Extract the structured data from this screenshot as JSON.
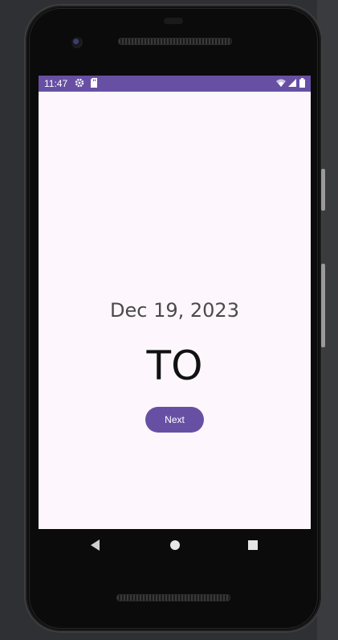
{
  "status_bar": {
    "time": "11:47",
    "icons": [
      "gear-icon",
      "sd-card-icon",
      "wifi-icon",
      "signal-icon",
      "battery-icon"
    ]
  },
  "main": {
    "date": "Dec 19, 2023",
    "word": "TO",
    "next_button_label": "Next"
  },
  "nav_bar": {
    "icons": [
      "back-icon",
      "home-icon",
      "recents-icon"
    ]
  },
  "colors": {
    "primary": "#6750a4",
    "screen_background": "#fdf7fd",
    "device_frame": "#0b0b0b",
    "outer_background": "#2f3033"
  }
}
